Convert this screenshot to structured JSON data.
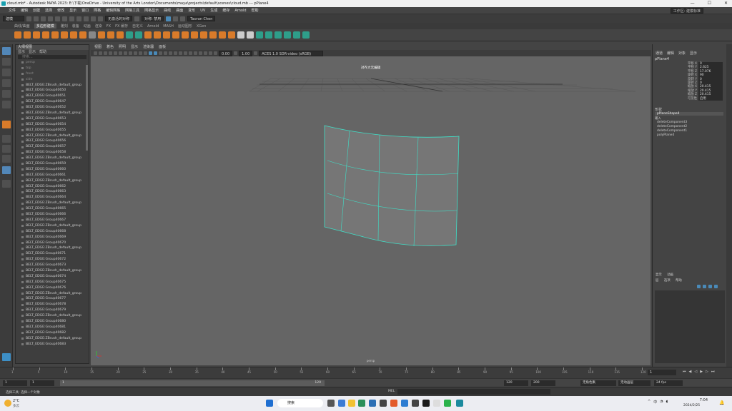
{
  "window": {
    "title": "cloud.mb* - Autodesk MAYA 2023: E:\\下载\\OneDrive - University of the Arts London\\Documents\\maya\\projects\\default\\scenes\\cloud.mb  ---  pPlane4"
  },
  "menubar": {
    "items": [
      "文件",
      "编辑",
      "创建",
      "选择",
      "修改",
      "显示",
      "窗口",
      "网格",
      "编辑网格",
      "网格工具",
      "网格显示",
      "曲线",
      "曲面",
      "变形",
      "UV",
      "生成",
      "缓存",
      "Arnold",
      "帮助"
    ],
    "workspace": "工作区: 建模标准"
  },
  "statusline": {
    "mode": "建模",
    "symmetry": "无激活的对称",
    "user": "Taoran Chen",
    "snap": "对称: 禁用"
  },
  "shelf_tabs": {
    "items": [
      "曲线/曲面",
      "多边形建模",
      "雕刻",
      "装备",
      "动画",
      "渲染",
      "FX",
      "FX 缓存",
      "自定义",
      "Arnold",
      "MASH",
      "运动图形",
      "XGen"
    ],
    "active": "多边形建模"
  },
  "outliner": {
    "title": "大纲视图",
    "menu": [
      "显示",
      "显示",
      "帮助"
    ],
    "search_placeholder": "搜索...",
    "rows": [
      "persp",
      "top",
      "front",
      "side",
      "BELT_EDGE:ZBrush_default_group",
      "BELT_EDGE:Group40650",
      "BELT_EDGE:Group40651",
      "BELT_EDGE:Group40647",
      "BELT_EDGE:Group40652",
      "BELT_EDGE:ZBrush_default_group",
      "BELT_EDGE:Group40653",
      "BELT_EDGE:Group40654",
      "BELT_EDGE:Group40655",
      "BELT_EDGE:ZBrush_default_group",
      "BELT_EDGE:Group40656",
      "BELT_EDGE:Group40657",
      "BELT_EDGE:Group40658",
      "BELT_EDGE:ZBrush_default_group",
      "BELT_EDGE:Group40659",
      "BELT_EDGE:Group40660",
      "BELT_EDGE:Group40661",
      "BELT_EDGE:ZBrush_default_group",
      "BELT_EDGE:Group40662",
      "BELT_EDGE:Group40663",
      "BELT_EDGE:Group40664",
      "BELT_EDGE:ZBrush_default_group",
      "BELT_EDGE:Group40665",
      "BELT_EDGE:Group40666",
      "BELT_EDGE:Group40667",
      "BELT_EDGE:ZBrush_default_group",
      "BELT_EDGE:Group40668",
      "BELT_EDGE:Group40669",
      "BELT_EDGE:Group40670",
      "BELT_EDGE:ZBrush_default_group",
      "BELT_EDGE:Group40671",
      "BELT_EDGE:Group40672",
      "BELT_EDGE:Group40673",
      "BELT_EDGE:ZBrush_default_group",
      "BELT_EDGE:Group40674",
      "BELT_EDGE:Group40675",
      "BELT_EDGE:Group40676",
      "BELT_EDGE:ZBrush_default_group",
      "BELT_EDGE:Group40677",
      "BELT_EDGE:Group40678",
      "BELT_EDGE:Group40679",
      "BELT_EDGE:ZBrush_default_group",
      "BELT_EDGE:Group40680",
      "BELT_EDGE:Group40681",
      "BELT_EDGE:Group40682",
      "BELT_EDGE:ZBrush_default_group",
      "BELT_EDGE:Group40683"
    ]
  },
  "viewport": {
    "menu": [
      "视图",
      "着色",
      "照明",
      "显示",
      "渲染器",
      "面板"
    ],
    "exposure": "0.00",
    "gamma": "1.00",
    "colorspace": "ACES 1.0 SDR-video (sRGB)",
    "overlay_title": "对齐大元编辑",
    "camera": "persp"
  },
  "channelbox": {
    "tabs": [
      "通道",
      "编辑",
      "对象",
      "显示"
    ],
    "object": "pPlane4",
    "attrs": [
      {
        "n": "平移 X",
        "v": "0"
      },
      {
        "n": "平移 Y",
        "v": "2.625"
      },
      {
        "n": "平移 Z",
        "v": "17.076"
      },
      {
        "n": "旋转 X",
        "v": "90"
      },
      {
        "n": "旋转 Y",
        "v": "0"
      },
      {
        "n": "旋转 Z",
        "v": "0"
      },
      {
        "n": "缩放 X",
        "v": "20.415"
      },
      {
        "n": "缩放 Y",
        "v": "20.415"
      },
      {
        "n": "缩放 Z",
        "v": "20.415"
      },
      {
        "n": "可见性",
        "v": "启用"
      }
    ],
    "shapes_label": "形状",
    "shape": "pPlaneShape4",
    "inputs_label": "输入",
    "inputs": [
      "deleteComponent3",
      "deleteComponent2",
      "deleteComponent1",
      "polyPlane4"
    ]
  },
  "layers": {
    "tabs": [
      "显示",
      "动画"
    ],
    "menu": [
      "层",
      "选项",
      "帮助"
    ]
  },
  "timeline": {
    "ticks": [
      "1",
      "5",
      "10",
      "15",
      "20",
      "25",
      "30",
      "35",
      "40",
      "45",
      "50",
      "55",
      "60",
      "65",
      "70",
      "75",
      "80",
      "85",
      "90",
      "95",
      "100",
      "105",
      "110",
      "115",
      "120"
    ],
    "current": "1"
  },
  "range": {
    "start": "1",
    "inner_start": "1",
    "inner_end": "120",
    "end": "120",
    "max": "200",
    "char_set": "无角色集",
    "anim_layer": "无动画层",
    "fps": "24 fps"
  },
  "cmd": {
    "lang": "MEL",
    "help": "选择工具: 选择一个对象"
  },
  "taskbar": {
    "weather_temp": "2°C",
    "weather_desc": "多云",
    "search": "搜索",
    "time": "7:04",
    "date": "2024/2/25"
  }
}
